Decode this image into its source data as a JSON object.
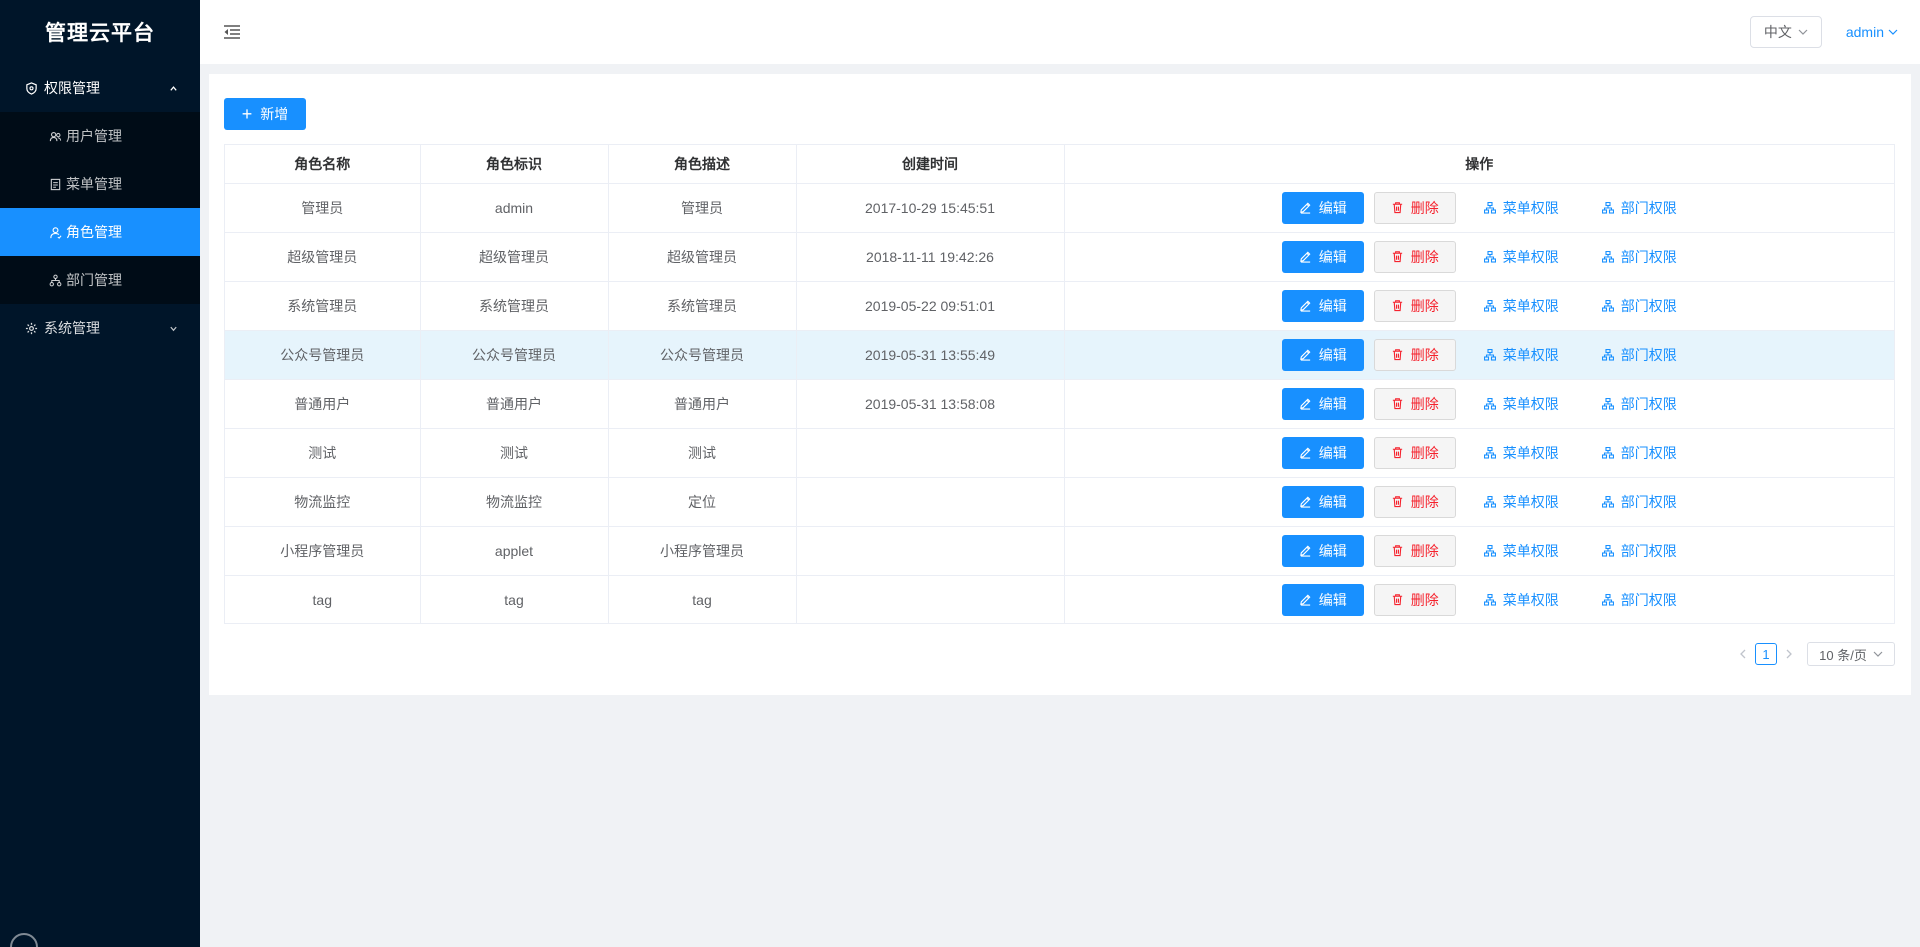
{
  "app": {
    "title": "管理云平台"
  },
  "sidebar": {
    "groups": [
      {
        "label": "权限管理",
        "icon": "shield-icon",
        "expanded": true
      },
      {
        "label": "系统管理",
        "icon": "gear-icon",
        "expanded": false
      }
    ],
    "items": [
      {
        "label": "用户管理",
        "icon": "users-icon",
        "active": false
      },
      {
        "label": "菜单管理",
        "icon": "document-icon",
        "active": false
      },
      {
        "label": "角色管理",
        "icon": "user-icon",
        "active": true
      },
      {
        "label": "部门管理",
        "icon": "org-tree-icon",
        "active": false
      }
    ]
  },
  "header": {
    "language": "中文",
    "user": "admin"
  },
  "toolbar": {
    "add_label": "新增"
  },
  "table": {
    "columns": [
      "角色名称",
      "角色标识",
      "角色描述",
      "创建时间",
      "操作"
    ],
    "rows": [
      {
        "name": "管理员",
        "key": "admin",
        "desc": "管理员",
        "created": "2017-10-29 15:45:51"
      },
      {
        "name": "超级管理员",
        "key": "超级管理员",
        "desc": "超级管理员",
        "created": "2018-11-11 19:42:26"
      },
      {
        "name": "系统管理员",
        "key": "系统管理员",
        "desc": "系统管理员",
        "created": "2019-05-22 09:51:01"
      },
      {
        "name": "公众号管理员",
        "key": "公众号管理员",
        "desc": "公众号管理员",
        "created": "2019-05-31 13:55:49"
      },
      {
        "name": "普通用户",
        "key": "普通用户",
        "desc": "普通用户",
        "created": "2019-05-31 13:58:08"
      },
      {
        "name": "测试",
        "key": "测试",
        "desc": "测试",
        "created": ""
      },
      {
        "name": "物流监控",
        "key": "物流监控",
        "desc": "定位",
        "created": ""
      },
      {
        "name": "小程序管理员",
        "key": "applet",
        "desc": "小程序管理员",
        "created": ""
      },
      {
        "name": "tag",
        "key": "tag",
        "desc": "tag",
        "created": ""
      }
    ],
    "actions": {
      "edit": "编辑",
      "delete": "删除",
      "menu_perm": "菜单权限",
      "dept_perm": "部门权限"
    }
  },
  "pagination": {
    "current": "1",
    "page_size": "10 条/页"
  },
  "colors": {
    "primary": "#1890ff",
    "danger": "#f5222d",
    "sidebar_bg": "#001529",
    "submenu_bg": "#000c17"
  }
}
